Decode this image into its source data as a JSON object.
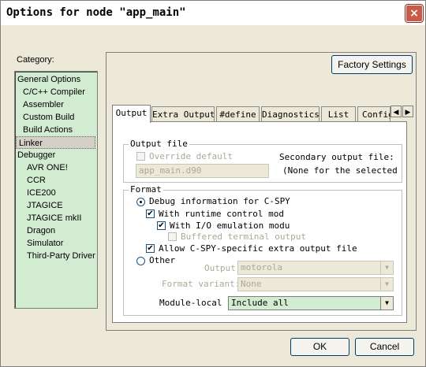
{
  "window": {
    "title": "Options for node \"app_main\"",
    "close_glyph": "×"
  },
  "category": {
    "label": "Category:",
    "items": [
      {
        "label": "General Options"
      },
      {
        "label": "C/C++ Compiler"
      },
      {
        "label": "Assembler"
      },
      {
        "label": "Custom Build"
      },
      {
        "label": "Build Actions"
      },
      {
        "label": "Linker",
        "selected": true
      },
      {
        "label": "Debugger"
      },
      {
        "label": "AVR ONE!"
      },
      {
        "label": "CCR"
      },
      {
        "label": "ICE200"
      },
      {
        "label": "JTAGICE"
      },
      {
        "label": "JTAGICE mkII"
      },
      {
        "label": "Dragon"
      },
      {
        "label": "Simulator"
      },
      {
        "label": "Third-Party Driver"
      }
    ]
  },
  "factory_settings": "Factory Settings",
  "tabs": [
    {
      "label": "Output",
      "active": true
    },
    {
      "label": "Extra Output"
    },
    {
      "label": "#define"
    },
    {
      "label": "Diagnostics"
    },
    {
      "label": "List"
    },
    {
      "label": "Config"
    }
  ],
  "tab_scroll": {
    "left": "◀",
    "right": "▶"
  },
  "output_file": {
    "group_title": "Output file",
    "override_label": "Override default",
    "override_checked": false,
    "filename": "app_main.d90",
    "secondary_label": "Secondary output file:",
    "secondary_value": "(None for the selected fo"
  },
  "format": {
    "group_title": "Format",
    "debug_info": "Debug information for C-SPY",
    "runtime_control": "With runtime control mod",
    "io_emulation": "With I/O emulation modu",
    "buffered_output": "Buffered terminal output",
    "allow_cspy": "Allow C-SPY-specific extra output file",
    "other": "Other",
    "output_label": "Output",
    "output_value": "motorola",
    "format_variant_label": "Format variant:",
    "format_variant_value": "None",
    "module_local_label": "Module-local",
    "module_local_value": "Include all",
    "check_glyph": "✔",
    "arrow_glyph": "▼"
  },
  "buttons": {
    "ok": "OK",
    "cancel": "Cancel"
  }
}
